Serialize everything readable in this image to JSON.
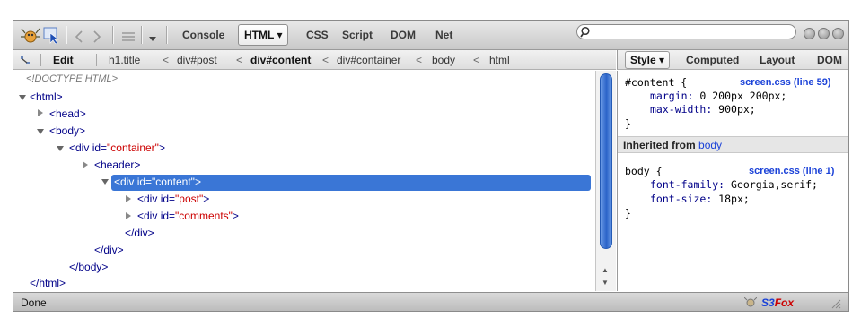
{
  "toolbar": {
    "tabs": [
      "Console",
      "HTML",
      "CSS",
      "Script",
      "DOM",
      "Net"
    ],
    "active_tab": "HTML",
    "active_tab_suffix": "▾",
    "search_placeholder": ""
  },
  "breadcrumb": {
    "edit_label": "Edit",
    "items": [
      "h1.title",
      "div#post",
      "div#content",
      "div#container",
      "body",
      "html"
    ],
    "current": "div#content",
    "separator": "<"
  },
  "side_tabs": {
    "items": [
      "Style",
      "Computed",
      "Layout",
      "DOM"
    ],
    "active": "Style",
    "active_suffix": "▾"
  },
  "tree": {
    "doctype": "<!DOCTYPE HTML>",
    "lines": [
      {
        "text_tag": "<html>"
      },
      {
        "text_tag": "<head>"
      },
      {
        "text_tag": "<body>"
      },
      {
        "tag_open": "<div",
        "attr": " id=",
        "val": "\"container\"",
        "tag_close": ">"
      },
      {
        "text_tag": "<header>"
      },
      {
        "tag_open": "<div",
        "attr": " id=",
        "val": "\"content\"",
        "tag_close": ">"
      },
      {
        "tag_open": "<div",
        "attr": " id=",
        "val": "\"post\"",
        "tag_close": ">"
      },
      {
        "tag_open": "<div",
        "attr": " id=",
        "val": "\"comments\"",
        "tag_close": ">"
      },
      {
        "text_tag": "</div>"
      },
      {
        "text_tag": "</div>"
      },
      {
        "text_tag": "</body>"
      },
      {
        "text_tag": "</html>"
      }
    ]
  },
  "styles": {
    "rule1": {
      "selector": "#content {",
      "source": "screen.css (line 59)",
      "props": [
        {
          "name": "margin",
          "value": "0 200px 200px;"
        },
        {
          "name": "max-width",
          "value": "900px;"
        }
      ],
      "close": "}"
    },
    "inherited_label": "Inherited from",
    "inherited_from": "body",
    "rule2": {
      "selector": "body {",
      "source": "screen.css (line 1)",
      "props": [
        {
          "name": "font-family",
          "value": "Georgia,serif;"
        },
        {
          "name": "font-size",
          "value": "18px;"
        }
      ],
      "close": "}"
    }
  },
  "status": {
    "text": "Done",
    "s3": "S3",
    "fox": "Fox"
  },
  "colors": {
    "selection": "#3a76d6",
    "tag": "#000088",
    "attr_value": "#cc0000",
    "link": "#1b42d8"
  },
  "icons": [
    "firebug-icon",
    "inspect-icon",
    "back-arrow-icon",
    "forward-arrow-icon",
    "list-icon",
    "dropdown-icon",
    "search-icon",
    "minimize-icon",
    "restore-icon",
    "close-icon",
    "tools-icon",
    "s3fox-icon",
    "resize-grip-icon"
  ]
}
